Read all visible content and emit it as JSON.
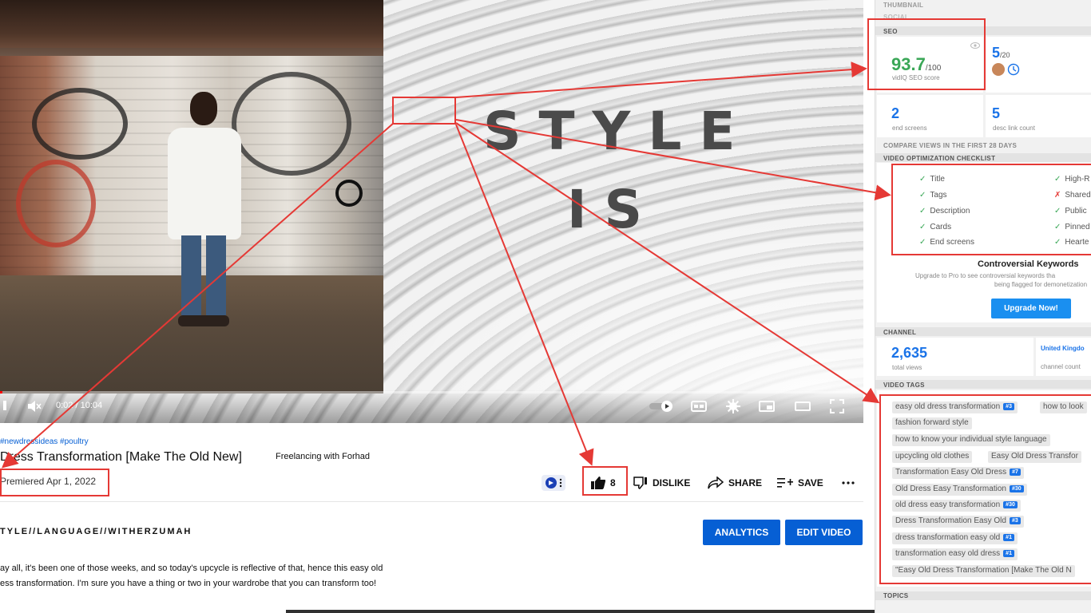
{
  "player": {
    "overlay_line1": "STYLE",
    "overlay_line2": "IS",
    "time_current": "0:02",
    "time_total": "10:04",
    "progress": 0.003
  },
  "video": {
    "hashtags": "#newdressideas #poultry",
    "title": "Dress Transformation [Make The Old New]",
    "channel": "Freelancing with Forhad",
    "premiered": "Premiered Apr 1, 2022",
    "likes": "8",
    "dislike_label": "DISLIKE",
    "share_label": "SHARE",
    "save_label": "SAVE",
    "desc_header": "TYLE//LANGUAGE//WITHERZUMAH",
    "desc_line1": "ay all, it's been one of those weeks, and so today's upcycle is reflective of that, hence this easy old",
    "desc_line2": "ess transformation. I'm sure you have a thing or two in your wardrobe that you can transform too!",
    "analytics_label": "ANALYTICS",
    "edit_label": "EDIT VIDEO"
  },
  "sidebar": {
    "thumbnail_label": "THUMBNAIL",
    "social_label": "SOCIAL",
    "seo_label": "SEO",
    "seo_score": "93.7",
    "seo_max": "/100",
    "seo_caption": "vidIQ SEO score",
    "score2": "5",
    "score2_max": "/20",
    "end_screens_value": "2",
    "end_screens_caption": "end screens",
    "desc_links_value": "5",
    "desc_links_caption": "desc link count",
    "compare_label": "COMPARE VIEWS IN THE FIRST 28 DAYS",
    "checklist_label": "VIDEO OPTIMIZATION CHECKLIST",
    "checklist_left": [
      "Title",
      "Tags",
      "Description",
      "Cards",
      "End screens"
    ],
    "checklist_right": [
      "High-R",
      "Shared",
      "Public",
      "Pinned",
      "Hearte"
    ],
    "controversial_title": "Controversial Keywords",
    "controversial_line1": "Upgrade to Pro to see controversial keywords tha",
    "controversial_line2": "being flagged for demonetization",
    "upgrade_label": "Upgrade Now!",
    "channel_label": "CHANNEL",
    "total_views": "2,635",
    "total_views_caption": "total views",
    "country": "United Kingdo",
    "country_caption": "channel count",
    "tags_label": "VIDEO TAGS",
    "tags": [
      {
        "text": "easy old dress transformation",
        "badge": "#3"
      },
      {
        "text": "how to look",
        "badge": ""
      },
      {
        "text": "fashion forward style",
        "badge": ""
      },
      {
        "text": "how to know your individual style language",
        "badge": ""
      },
      {
        "text": "upcycling old clothes",
        "badge": ""
      },
      {
        "text": "Easy Old Dress Transfor",
        "badge": ""
      },
      {
        "text": "Transformation Easy Old Dress",
        "badge": "#7"
      },
      {
        "text": "Old Dress Easy Transformation",
        "badge": "#30"
      },
      {
        "text": "old dress easy transformation",
        "badge": "#30"
      },
      {
        "text": "Dress Transformation Easy Old",
        "badge": "#3"
      },
      {
        "text": "dress transformation easy old",
        "badge": "#1"
      },
      {
        "text": "transformation easy old dress",
        "badge": "#1"
      },
      {
        "text": "\"Easy Old Dress Transformation [Make The Old N",
        "badge": ""
      }
    ],
    "topics_label": "TOPICS"
  },
  "colors": {
    "accent_red": "#e53935",
    "youtube_blue": "#065fd4",
    "seo_green": "#3aa757",
    "vidiq_blue": "#1a73e8"
  }
}
